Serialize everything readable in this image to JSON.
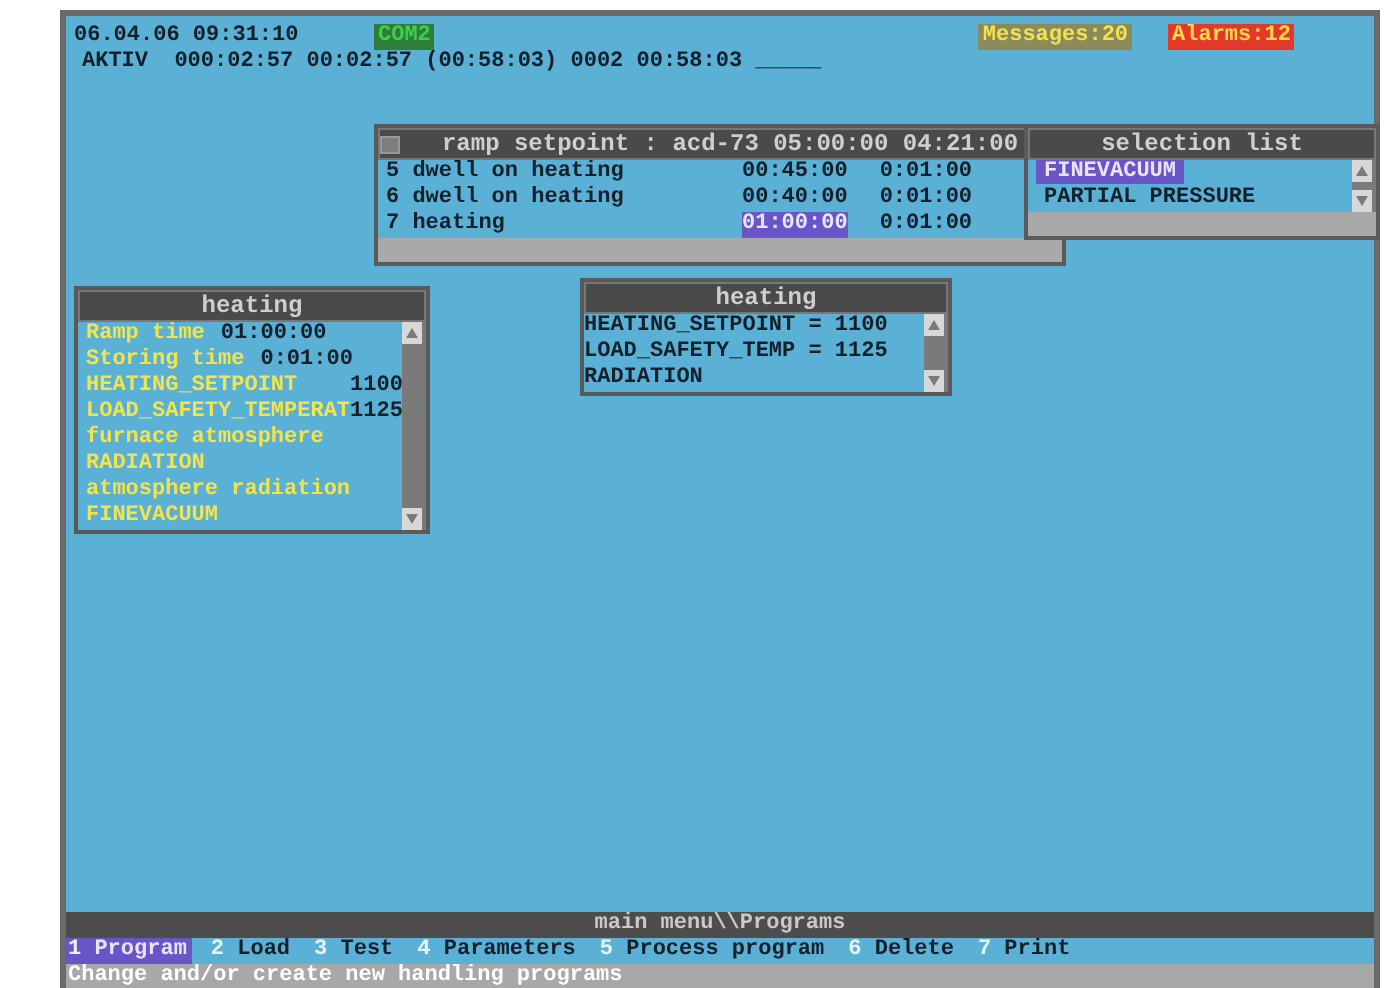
{
  "header": {
    "datetime": "06.04.06 09:31:10",
    "port": "COM2",
    "messages": "Messages:20",
    "alarms": "Alarms:12",
    "status_line": "AKTIV  000:02:57 00:02:57 (00:58:03) 0002 00:58:03 _____"
  },
  "ramp_window": {
    "title": "ramp setpoint : acd-73 05:00:00 04:21:00",
    "rows": [
      {
        "label": "5 dwell on heating",
        "time": "00:45:00",
        "duration": "0:01:00",
        "selected": false
      },
      {
        "label": "6 dwell on heating",
        "time": "00:40:00",
        "duration": "0:01:00",
        "selected": false
      },
      {
        "label": "7 heating",
        "time": "01:00:00",
        "duration": "0:01:00",
        "selected": true
      }
    ]
  },
  "selection_list": {
    "title": "selection list",
    "items": [
      {
        "label": "FINEVACUUM",
        "selected": true
      },
      {
        "label": "PARTIAL PRESSURE",
        "selected": false
      }
    ]
  },
  "heating_left": {
    "title": "heating",
    "items": [
      {
        "label": "Ramp time",
        "value": "01:00:00"
      },
      {
        "label": "Storing time",
        "value": "0:01:00"
      },
      {
        "label": "HEATING_SETPOINT",
        "value": "1100"
      },
      {
        "label": "LOAD_SAFETY_TEMPERAT",
        "value": "1125"
      },
      {
        "label": "furnace atmosphere"
      },
      {
        "label": "RADIATION"
      },
      {
        "label": "atmosphere radiation"
      },
      {
        "label": "FINEVACUUM"
      }
    ]
  },
  "heating_right": {
    "title": "heating",
    "lines": [
      "HEATING_SETPOINT = 1100",
      "LOAD_SAFETY_TEMP = 1125",
      "RADIATION"
    ]
  },
  "menu": {
    "title": "main menu\\\\Programs",
    "items": [
      {
        "number": "1",
        "label": "Program",
        "selected": true
      },
      {
        "number": "2",
        "label": "Load",
        "selected": false
      },
      {
        "number": "3",
        "label": "Test",
        "selected": false
      },
      {
        "number": "4",
        "label": "Parameters",
        "selected": false
      },
      {
        "number": "5",
        "label": "Process program",
        "selected": false
      },
      {
        "number": "6",
        "label": "Delete",
        "selected": false
      },
      {
        "number": "7",
        "label": "Print",
        "selected": false
      }
    ],
    "hint": "Change and/or create new handling programs"
  }
}
